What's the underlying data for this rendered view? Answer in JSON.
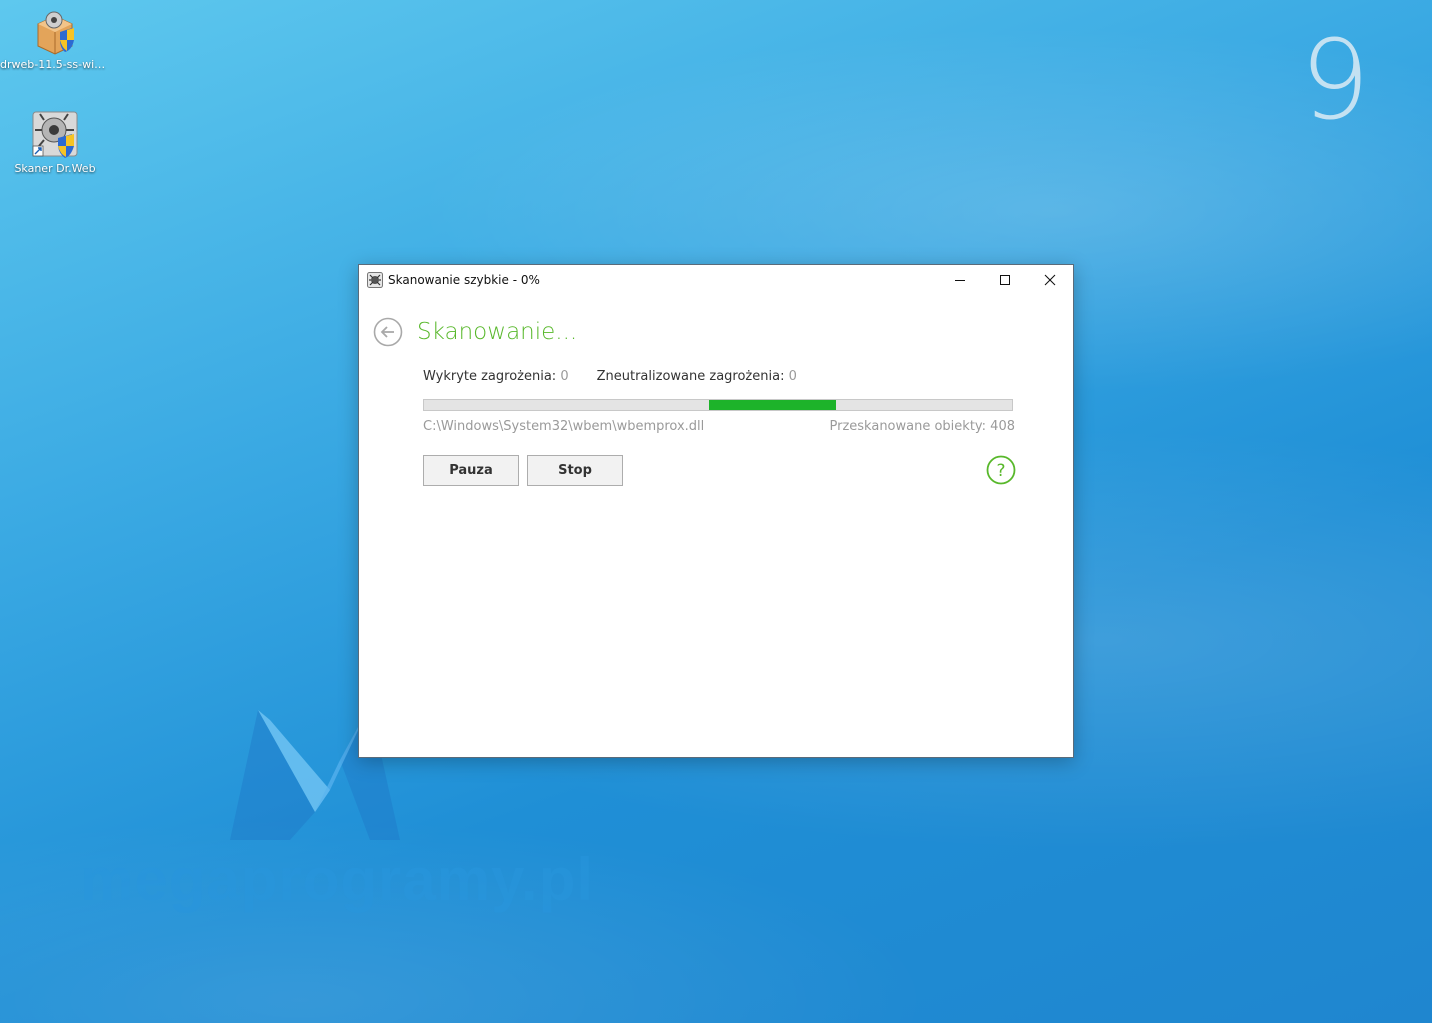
{
  "desktop": {
    "icons": [
      {
        "label": "drweb-11.5-ss-win...",
        "icon": "installer-box-icon"
      },
      {
        "label": "Skaner Dr.Web",
        "icon": "drweb-scanner-icon"
      }
    ],
    "corner_number": "9",
    "watermark_text": "megaprogramy.pl"
  },
  "window": {
    "title": "Skanowanie szybkie - 0%",
    "heading": "Skanowanie...",
    "accent_color": "#58b82b",
    "progress_color": "#1db32a",
    "stats": {
      "detected_label": "Wykryte zagrożenia:",
      "detected_value": "0",
      "neutralized_label": "Zneutralizowane zagrożenia:",
      "neutralized_value": "0"
    },
    "progress": {
      "indeterminate": true,
      "highlight_start_fraction": 0.485,
      "highlight_end_fraction": 0.7
    },
    "current_file": "C:\\Windows\\System32\\wbem\\wbemprox.dll",
    "scanned_label": "Przeskanowane obiekty: 408",
    "buttons": {
      "pause": "Pauza",
      "stop": "Stop"
    },
    "help_glyph": "?"
  }
}
